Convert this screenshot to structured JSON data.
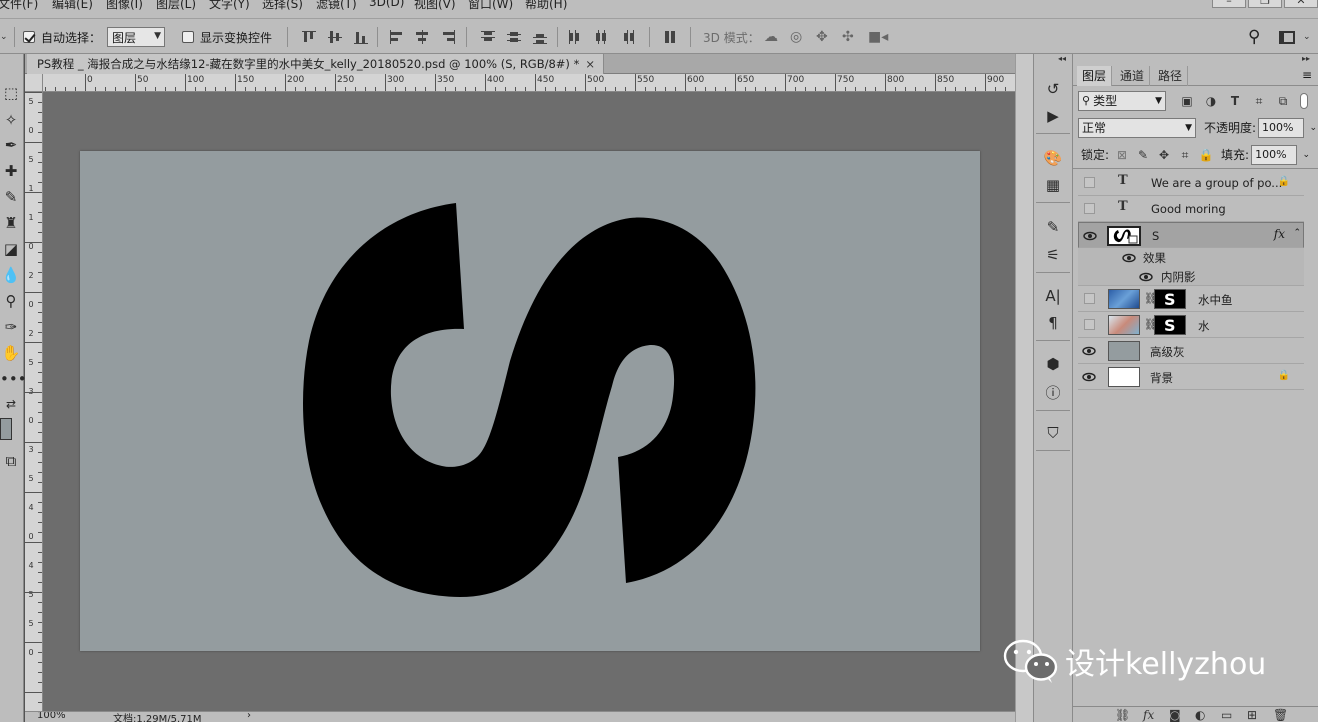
{
  "menu": [
    "文件(F)",
    "编辑(E)",
    "图像(I)",
    "图层(L)",
    "文字(Y)",
    "选择(S)",
    "滤镜(T)",
    "3D(D)",
    "视图(V)",
    "窗口(W)",
    "帮助(H)"
  ],
  "window_controls": [
    "–",
    "❐",
    "✕"
  ],
  "options": {
    "auto_select_label": "自动选择：",
    "auto_select_checked": true,
    "auto_select_target": "图层",
    "show_transform_label": "显示变换控件",
    "mode_3d_label": "3D 模式："
  },
  "document": {
    "tab_title": "PS教程 _ 海报合成之与水结缘12-藏在数字里的水中美女_kelly_20180520.psd @ 100% (S, RGB/8#) *",
    "tab_close": "×",
    "ruler_labels": [
      "0",
      "50",
      "100",
      "150",
      "200",
      "250",
      "300",
      "350",
      "400",
      "450",
      "500",
      "550",
      "600",
      "650",
      "700",
      "750",
      "800",
      "850",
      "900"
    ],
    "vruler_labels": [
      "5",
      "0",
      "5",
      "1",
      "1",
      "0",
      "2",
      "0",
      "2",
      "5",
      "3",
      "0",
      "3",
      "5",
      "4",
      "0",
      "4",
      "5",
      "5",
      "0"
    ],
    "canvas_color": "#949c9f",
    "shape_color": "#000000",
    "zoom": "100%",
    "doc_info": "文档:1.29M/5.71M"
  },
  "layers_panel": {
    "tabs": [
      "图层",
      "通道",
      "路径"
    ],
    "active_tab": "图层",
    "filter_label": "类型",
    "blend_mode": "正常",
    "opacity_label": "不透明度:",
    "opacity_value": "100%",
    "lock_label": "锁定:",
    "fill_label": "填充:",
    "fill_value": "100%",
    "layers": [
      {
        "name": "We are a group of po...",
        "type": "text",
        "visible": false,
        "locked": true
      },
      {
        "name": "Good moring",
        "type": "text",
        "visible": false
      },
      {
        "name": "S",
        "type": "smart",
        "visible": true,
        "selected": true,
        "fx": "fx"
      },
      {
        "name": "效果",
        "type": "effects"
      },
      {
        "name": "内阴影",
        "type": "effect"
      },
      {
        "name": "水中鱼",
        "type": "masked",
        "visible": false
      },
      {
        "name": "水",
        "type": "masked",
        "visible": false
      },
      {
        "name": "高级灰",
        "type": "fill",
        "visible": true
      },
      {
        "name": "背景",
        "type": "background",
        "visible": true,
        "locked": true
      }
    ]
  },
  "watermark": "设计kellyzhou"
}
